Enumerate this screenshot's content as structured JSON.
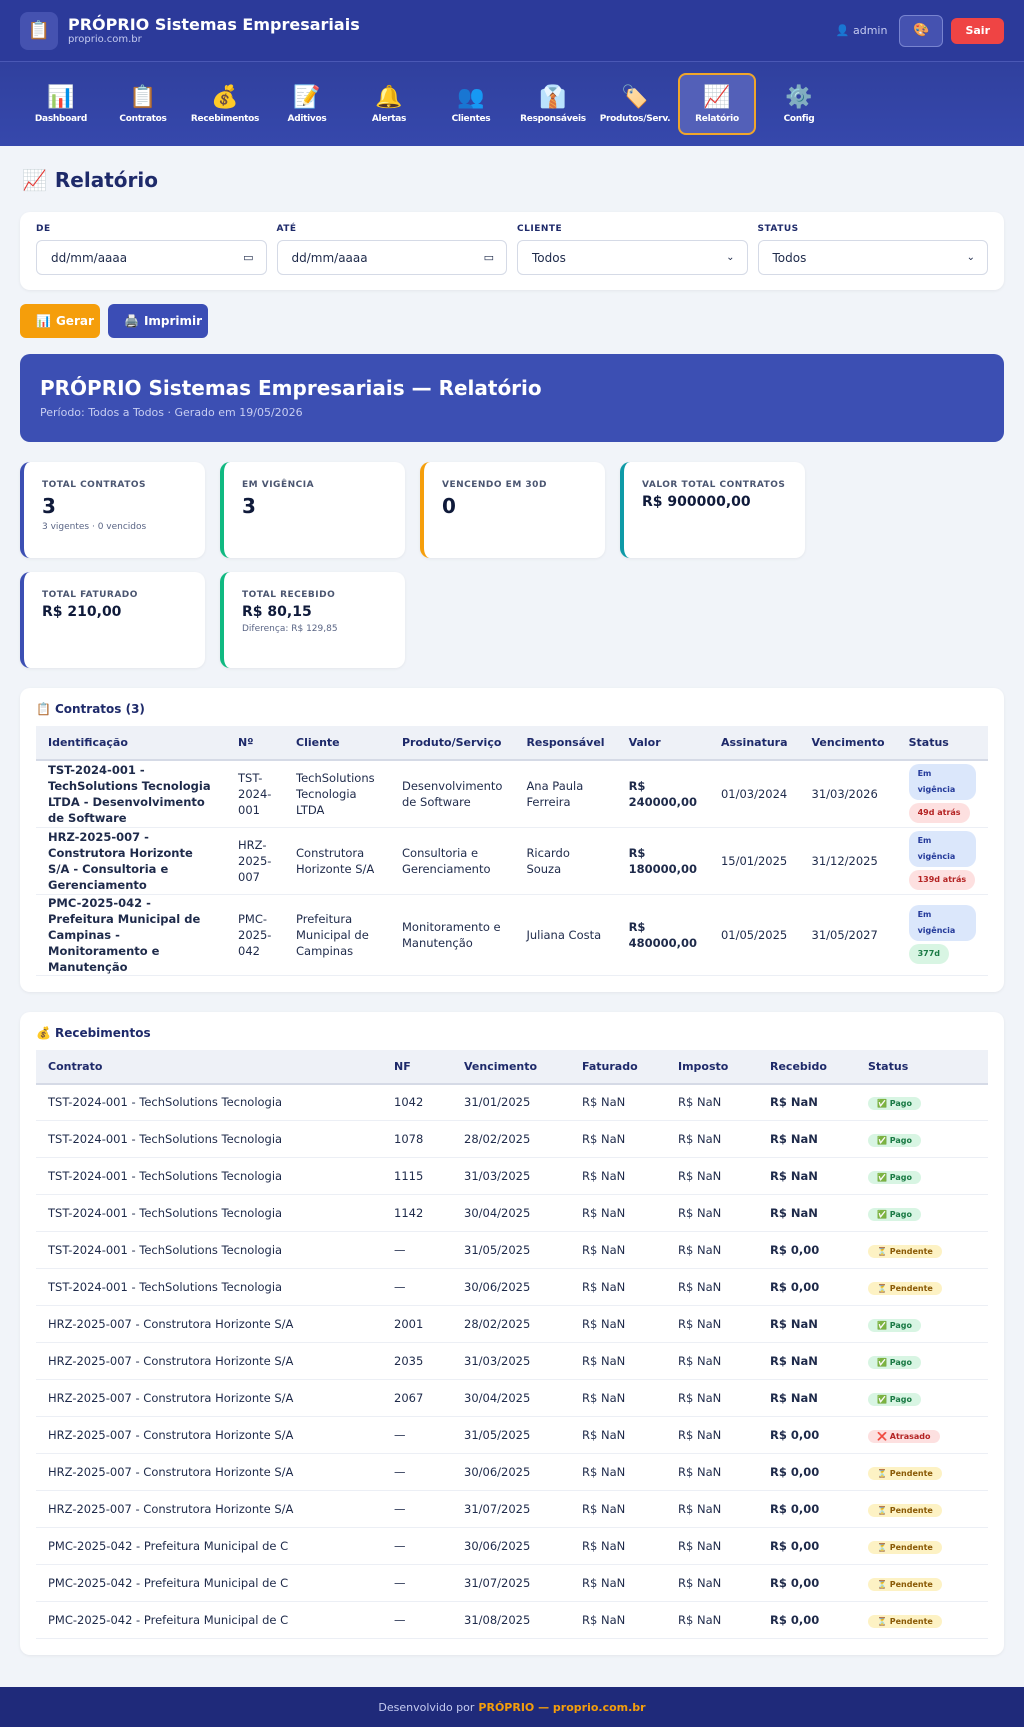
{
  "header": {
    "logo_icon": "clipboard-icon",
    "title": "PRÓPRIO Sistemas Empresariais",
    "subtitle": "proprio.com.br",
    "user": "admin",
    "logout": "Sair"
  },
  "nav": [
    {
      "icon": "📊",
      "label": "Dashboard",
      "name": "dashboard"
    },
    {
      "icon": "📋",
      "label": "Contratos",
      "name": "contratos"
    },
    {
      "icon": "💰",
      "label": "Recebimentos",
      "name": "recebimentos"
    },
    {
      "icon": "📝",
      "label": "Aditivos",
      "name": "aditivos"
    },
    {
      "icon": "🔔",
      "label": "Alertas",
      "name": "alertas"
    },
    {
      "icon": "👥",
      "label": "Clientes",
      "name": "clientes"
    },
    {
      "icon": "👔",
      "label": "Responsáveis",
      "name": "responsaveis"
    },
    {
      "icon": "🏷️",
      "label": "Produtos/Serv.",
      "name": "produtos"
    },
    {
      "icon": "📈",
      "label": "Relatório",
      "name": "relatorio",
      "active": true
    },
    {
      "icon": "⚙️",
      "label": "Config",
      "name": "config"
    }
  ],
  "page": {
    "title": "Relatório"
  },
  "filters": {
    "de_label": "DE",
    "de_value": "dd/mm/aaaa",
    "ate_label": "ATÉ",
    "ate_value": "dd/mm/aaaa",
    "cliente_label": "CLIENTE",
    "cliente_value": "Todos",
    "status_label": "STATUS",
    "status_value": "Todos"
  },
  "actions": {
    "generate": "Gerar",
    "print": "Imprimir"
  },
  "banner": {
    "title": "PRÓPRIO Sistemas Empresariais — Relatório",
    "subtitle": "Período: Todos a Todos · Gerado em 19/05/2026"
  },
  "kpis": [
    {
      "label": "TOTAL CONTRATOS",
      "value": "3",
      "note": "3 vigentes · 0 vencidos",
      "color": "#3c4fb3",
      "small": false
    },
    {
      "label": "EM VIGÊNCIA",
      "value": "3",
      "note": "",
      "color": "#10b981",
      "small": false
    },
    {
      "label": "VENCENDO EM 30D",
      "value": "0",
      "note": "",
      "color": "#f59e0b",
      "small": false
    },
    {
      "label": "VALOR TOTAL CONTRATOS",
      "value": "R$ 900000,00",
      "note": "",
      "color": "#0e9aa7",
      "small": true
    },
    {
      "label": "TOTAL FATURADO",
      "value": "R$ 210,00",
      "note": "",
      "color": "#3c4fb3",
      "small": true
    },
    {
      "label": "TOTAL RECEBIDO",
      "value": "R$ 80,15",
      "note": "Diferença: R$ 129,85",
      "color": "#10b981",
      "small": true
    }
  ],
  "contratos": {
    "title": "Contratos (3)",
    "headers": [
      "Identificação",
      "Nº",
      "Cliente",
      "Produto/Serviço",
      "Responsável",
      "Valor",
      "Assinatura",
      "Vencimento",
      "Status"
    ],
    "rows": [
      {
        "id": "TST-2024-001 - TechSolutions Tecnologia LTDA - Desenvolvimento de Software",
        "num": "TST-2024-001",
        "cliente": "TechSolutions Tecnologia LTDA",
        "produto": "Desenvolvimento de Software",
        "resp": "Ana Paula Ferreira",
        "valor": "R$ 240000,00",
        "assinatura": "01/03/2024",
        "vencimento": "31/03/2026",
        "status": "Em vigência",
        "tempo": "49d atrás",
        "tempo_class": "b-red"
      },
      {
        "id": "HRZ-2025-007 - Construtora Horizonte S/A - Consultoria e Gerenciamento",
        "num": "HRZ-2025-007",
        "cliente": "Construtora Horizonte S/A",
        "produto": "Consultoria e Gerenciamento",
        "resp": "Ricardo Souza",
        "valor": "R$ 180000,00",
        "assinatura": "15/01/2025",
        "vencimento": "31/12/2025",
        "status": "Em vigência",
        "tempo": "139d atrás",
        "tempo_class": "b-red"
      },
      {
        "id": "PMC-2025-042 - Prefeitura Municipal de Campinas - Monitoramento e Manutenção",
        "num": "PMC-2025-042",
        "cliente": "Prefeitura Municipal de Campinas",
        "produto": "Monitoramento e Manutenção",
        "resp": "Juliana Costa",
        "valor": "R$ 480000,00",
        "assinatura": "01/05/2025",
        "vencimento": "31/05/2027",
        "status": "Em vigência",
        "tempo": "377d",
        "tempo_class": "b-green"
      }
    ]
  },
  "recebimentos": {
    "title": "Recebimentos",
    "headers": [
      "Contrato",
      "NF",
      "Vencimento",
      "Faturado",
      "Imposto",
      "Recebido",
      "Status"
    ],
    "rows": [
      {
        "contrato": "TST-2024-001 - TechSolutions Tecnologia",
        "nf": "1042",
        "venc": "31/01/2025",
        "fat": "R$ NaN",
        "imp": "R$ NaN",
        "rec": "R$ NaN",
        "status": "✅ Pago",
        "cls": "b-green"
      },
      {
        "contrato": "TST-2024-001 - TechSolutions Tecnologia",
        "nf": "1078",
        "venc": "28/02/2025",
        "fat": "R$ NaN",
        "imp": "R$ NaN",
        "rec": "R$ NaN",
        "status": "✅ Pago",
        "cls": "b-green"
      },
      {
        "contrato": "TST-2024-001 - TechSolutions Tecnologia",
        "nf": "1115",
        "venc": "31/03/2025",
        "fat": "R$ NaN",
        "imp": "R$ NaN",
        "rec": "R$ NaN",
        "status": "✅ Pago",
        "cls": "b-green"
      },
      {
        "contrato": "TST-2024-001 - TechSolutions Tecnologia",
        "nf": "1142",
        "venc": "30/04/2025",
        "fat": "R$ NaN",
        "imp": "R$ NaN",
        "rec": "R$ NaN",
        "status": "✅ Pago",
        "cls": "b-green"
      },
      {
        "contrato": "TST-2024-001 - TechSolutions Tecnologia",
        "nf": "—",
        "venc": "31/05/2025",
        "fat": "R$ NaN",
        "imp": "R$ NaN",
        "rec": "R$ 0,00",
        "status": "⏳ Pendente",
        "cls": "b-yellow"
      },
      {
        "contrato": "TST-2024-001 - TechSolutions Tecnologia",
        "nf": "—",
        "venc": "30/06/2025",
        "fat": "R$ NaN",
        "imp": "R$ NaN",
        "rec": "R$ 0,00",
        "status": "⏳ Pendente",
        "cls": "b-yellow"
      },
      {
        "contrato": "HRZ-2025-007 - Construtora Horizonte S/A",
        "nf": "2001",
        "venc": "28/02/2025",
        "fat": "R$ NaN",
        "imp": "R$ NaN",
        "rec": "R$ NaN",
        "status": "✅ Pago",
        "cls": "b-green"
      },
      {
        "contrato": "HRZ-2025-007 - Construtora Horizonte S/A",
        "nf": "2035",
        "venc": "31/03/2025",
        "fat": "R$ NaN",
        "imp": "R$ NaN",
        "rec": "R$ NaN",
        "status": "✅ Pago",
        "cls": "b-green"
      },
      {
        "contrato": "HRZ-2025-007 - Construtora Horizonte S/A",
        "nf": "2067",
        "venc": "30/04/2025",
        "fat": "R$ NaN",
        "imp": "R$ NaN",
        "rec": "R$ NaN",
        "status": "✅ Pago",
        "cls": "b-green"
      },
      {
        "contrato": "HRZ-2025-007 - Construtora Horizonte S/A",
        "nf": "—",
        "venc": "31/05/2025",
        "fat": "R$ NaN",
        "imp": "R$ NaN",
        "rec": "R$ 0,00",
        "status": "❌ Atrasado",
        "cls": "b-red"
      },
      {
        "contrato": "HRZ-2025-007 - Construtora Horizonte S/A",
        "nf": "—",
        "venc": "30/06/2025",
        "fat": "R$ NaN",
        "imp": "R$ NaN",
        "rec": "R$ 0,00",
        "status": "⏳ Pendente",
        "cls": "b-yellow"
      },
      {
        "contrato": "HRZ-2025-007 - Construtora Horizonte S/A",
        "nf": "—",
        "venc": "31/07/2025",
        "fat": "R$ NaN",
        "imp": "R$ NaN",
        "rec": "R$ 0,00",
        "status": "⏳ Pendente",
        "cls": "b-yellow"
      },
      {
        "contrato": "PMC-2025-042 - Prefeitura Municipal de C",
        "nf": "—",
        "venc": "30/06/2025",
        "fat": "R$ NaN",
        "imp": "R$ NaN",
        "rec": "R$ 0,00",
        "status": "⏳ Pendente",
        "cls": "b-yellow"
      },
      {
        "contrato": "PMC-2025-042 - Prefeitura Municipal de C",
        "nf": "—",
        "venc": "31/07/2025",
        "fat": "R$ NaN",
        "imp": "R$ NaN",
        "rec": "R$ 0,00",
        "status": "⏳ Pendente",
        "cls": "b-yellow"
      },
      {
        "contrato": "PMC-2025-042 - Prefeitura Municipal de C",
        "nf": "—",
        "venc": "31/08/2025",
        "fat": "R$ NaN",
        "imp": "R$ NaN",
        "rec": "R$ 0,00",
        "status": "⏳ Pendente",
        "cls": "b-yellow"
      }
    ]
  },
  "footer": {
    "prefix": "Desenvolvido por",
    "brand": "PRÓPRIO — proprio.com.br"
  }
}
